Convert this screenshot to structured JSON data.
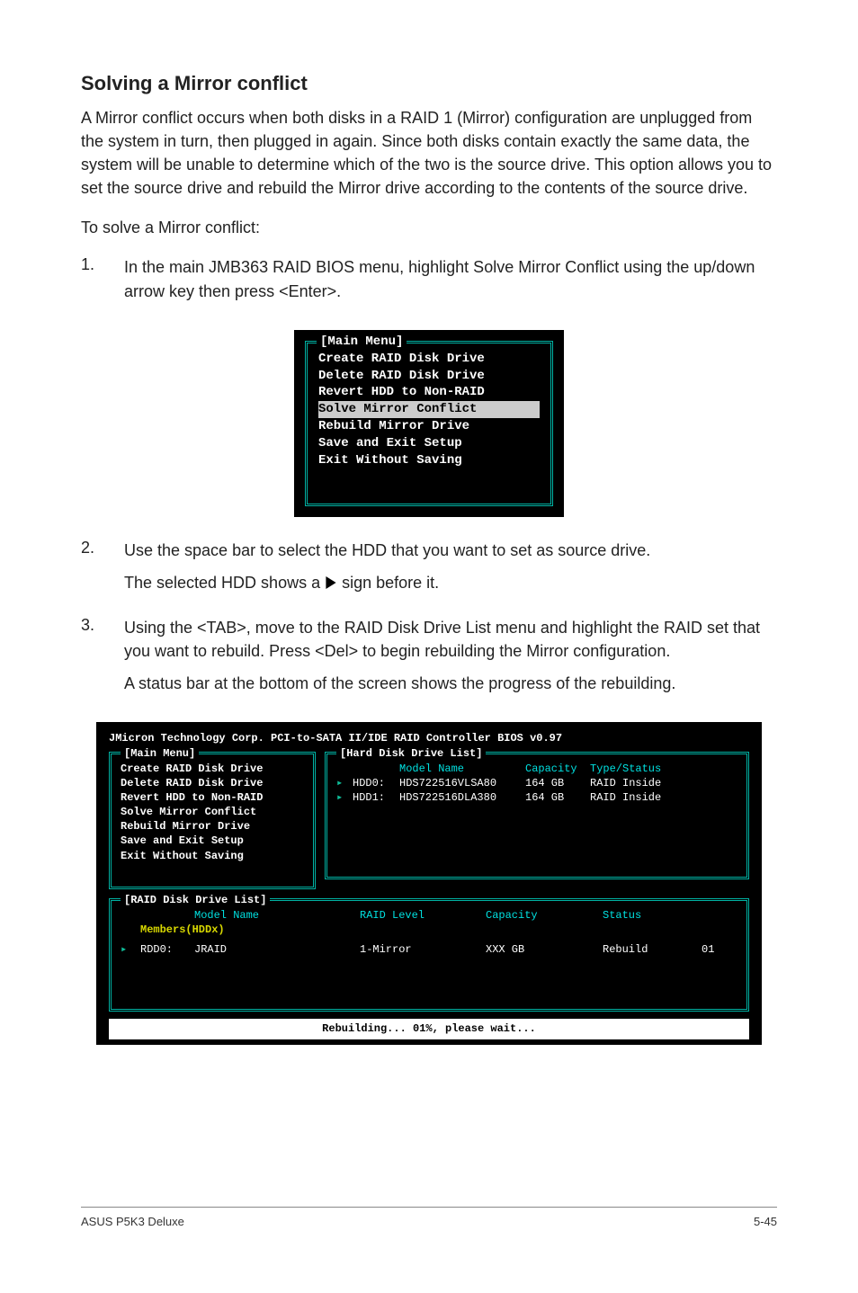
{
  "section_title": "Solving a Mirror conflict",
  "intro": "A Mirror conflict occurs when both disks in a RAID 1 (Mirror) configuration are unplugged from the system in turn, then plugged in again. Since both disks contain exactly the same data, the system will be unable to determine which of the two is the source drive. This option allows you to set the source drive and rebuild the Mirror drive according to the contents of the source drive.",
  "lead": "To solve a Mirror conflict:",
  "steps": {
    "1": "In the main JMB363 RAID BIOS menu, highlight Solve Mirror Conflict using the up/down arrow key then press <Enter>.",
    "2a": "Use the space bar to select the HDD that you want to set as source drive.",
    "2b_pre": "The selected HDD shows a ",
    "2b_post": " sign before it.",
    "3a": "Using the <TAB>, move to the RAID Disk Drive List menu and highlight the RAID set that you want to rebuild. Press <Del> to begin rebuilding the Mirror configuration.",
    "3b": "A status bar at the bottom of the screen shows the progress of the rebuilding."
  },
  "small_menu": {
    "title": "[Main Menu]",
    "items": [
      "Create RAID Disk Drive",
      "Delete RAID Disk Drive",
      "Revert HDD to Non-RAID",
      "Solve Mirror Conflict",
      "Rebuild Mirror Drive",
      "Save and Exit Setup",
      "Exit Without Saving"
    ],
    "highlighted_index": 3
  },
  "wide_bios": {
    "header": "JMicron Technology Corp. PCI-to-SATA II/IDE RAID Controller BIOS v0.97",
    "main_title": "[Main Menu]",
    "hdd_title": "[Hard Disk Drive List]",
    "hdd_headers": {
      "model": "Model Name",
      "capacity": "Capacity",
      "type": "Type/Status"
    },
    "hdds": [
      {
        "slot": "HDD0:",
        "model": "HDS722516VLSA80",
        "cap": "164 GB",
        "type": "RAID Inside"
      },
      {
        "slot": "HDD1:",
        "model": "HDS722516DLA380",
        "cap": "164 GB",
        "type": "RAID Inside"
      }
    ],
    "raid_title": "[RAID Disk Drive List]",
    "raid_headers": {
      "model": "Model Name",
      "level": "RAID Level",
      "capacity": "Capacity",
      "status": "Status"
    },
    "raid_members_label": "Members(HDDx)",
    "raid_rows": [
      {
        "slot": "RDD0:",
        "model": "JRAID",
        "level": "1-Mirror",
        "cap": "XXX GB",
        "status": "Rebuild",
        "extra": "01"
      }
    ],
    "status_bar": "Rebuilding... 01%, please wait..."
  },
  "footer": {
    "left": "ASUS P5K3 Deluxe",
    "right": "5-45"
  }
}
